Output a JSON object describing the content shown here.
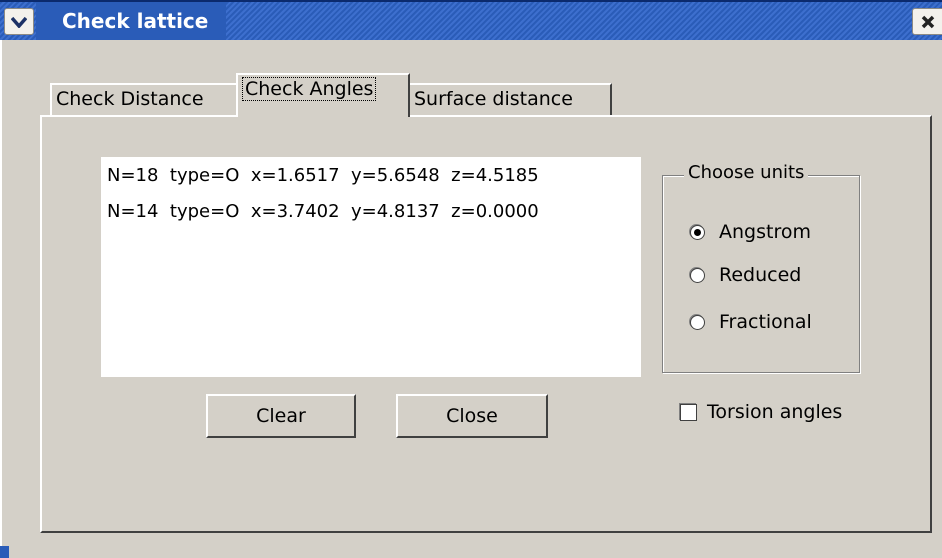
{
  "window": {
    "title": "Check lattice"
  },
  "tabs": [
    {
      "label": "Check Distance"
    },
    {
      "label": "Check Angles"
    },
    {
      "label": "Surface distance"
    }
  ],
  "list": {
    "rows": [
      {
        "n": "N=18",
        "type": "type=O",
        "x": "x=1.6517",
        "y": "y=5.6548",
        "z": "z=4.5185"
      },
      {
        "n": "N=14",
        "type": "type=O",
        "x": "x=3.7402",
        "y": "y=4.8137",
        "z": "z=0.0000"
      }
    ]
  },
  "units": {
    "legend": "Choose units",
    "options": [
      {
        "label": "Angstrom",
        "selected": true
      },
      {
        "label": "Reduced",
        "selected": false
      },
      {
        "label": "Fractional",
        "selected": false
      }
    ]
  },
  "buttons": {
    "clear": "Clear",
    "close": "Close"
  },
  "torsion": {
    "label": "Torsion angles",
    "checked": false
  },
  "icons": {
    "window_menu": "chevron-down-icon",
    "window_close": "close-x-icon"
  }
}
